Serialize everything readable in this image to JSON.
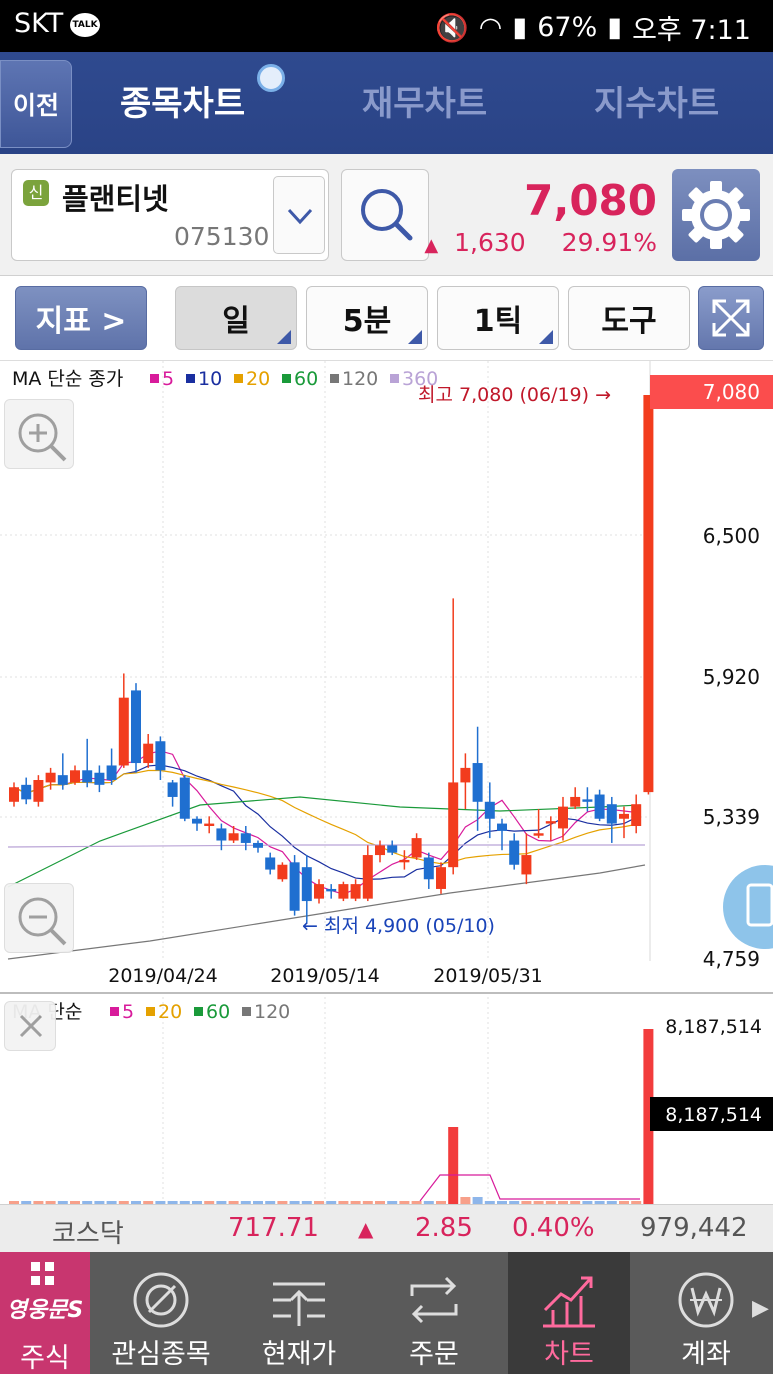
{
  "status_bar": {
    "carrier": "SKT",
    "talk_badge": "TALK",
    "battery": "67%",
    "time": "오후 7:11"
  },
  "header": {
    "back_label": "이전",
    "tabs": [
      {
        "label": "종목차트",
        "active": true
      },
      {
        "label": "재무차트",
        "active": false
      },
      {
        "label": "지수차트",
        "active": false
      }
    ]
  },
  "stock": {
    "badge": "신",
    "name": "플랜티넷",
    "code": "075130",
    "price": "7,080",
    "change_arrow": "▲",
    "change": "1,630",
    "change_pct": "29.91%",
    "up_color": "#d8245c"
  },
  "toolbar": {
    "indicator_label": "지표 >",
    "period_day": "일",
    "period_5min": "5분",
    "period_1tick": "1틱",
    "tools_label": "도구"
  },
  "price_chart": {
    "legend_prefix": "MA 단순 종가",
    "legend": [
      {
        "label": "5",
        "color": "#d81b9b"
      },
      {
        "label": "10",
        "color": "#1a2fa0"
      },
      {
        "label": "20",
        "color": "#e5a100"
      },
      {
        "label": "60",
        "color": "#1a9a3a"
      },
      {
        "label": "120",
        "color": "#777777"
      },
      {
        "label": "360",
        "color": "#b9a3d6"
      }
    ],
    "high_annotation": "최고 7,080 (06/19) →",
    "low_annotation": "← 최저 4,900 (05/10)",
    "current_price_tag": "7,080",
    "y_ticks": [
      "7,080",
      "6,500",
      "5,920",
      "5,339",
      "4,759"
    ],
    "x_ticks": [
      "2019/04/24",
      "2019/05/14",
      "2019/05/31"
    ]
  },
  "volume_chart": {
    "legend_prefix": "MA 단순",
    "legend": [
      {
        "label": "5",
        "color": "#d81b9b"
      },
      {
        "label": "20",
        "color": "#e5a100"
      },
      {
        "label": "60",
        "color": "#1a9a3a"
      },
      {
        "label": "120",
        "color": "#777777"
      }
    ],
    "max_label": "8,187,514",
    "current_tag": "8,187,514"
  },
  "chart_data": {
    "type": "candlestick",
    "title": "",
    "ylim": [
      4759,
      7080
    ],
    "y_ticks": [
      7080,
      6500,
      5920,
      5339,
      4759
    ],
    "x_ticks": [
      "2019/04/24",
      "2019/05/14",
      "2019/05/31"
    ],
    "high": {
      "value": 7080,
      "date": "06/19"
    },
    "low": {
      "value": 4900,
      "date": "05/10"
    },
    "candles": [
      {
        "o": 5400,
        "c": 5460,
        "h": 5480,
        "l": 5380
      },
      {
        "o": 5470,
        "c": 5410,
        "h": 5500,
        "l": 5390
      },
      {
        "o": 5400,
        "c": 5490,
        "h": 5510,
        "l": 5380
      },
      {
        "o": 5480,
        "c": 5520,
        "h": 5540,
        "l": 5450
      },
      {
        "o": 5510,
        "c": 5470,
        "h": 5600,
        "l": 5450
      },
      {
        "o": 5480,
        "c": 5530,
        "h": 5550,
        "l": 5470
      },
      {
        "o": 5530,
        "c": 5480,
        "h": 5660,
        "l": 5460
      },
      {
        "o": 5520,
        "c": 5470,
        "h": 5550,
        "l": 5440
      },
      {
        "o": 5550,
        "c": 5490,
        "h": 5620,
        "l": 5470
      },
      {
        "o": 5550,
        "c": 5830,
        "h": 5930,
        "l": 5540
      },
      {
        "o": 5860,
        "c": 5560,
        "h": 5890,
        "l": 5520
      },
      {
        "o": 5560,
        "c": 5640,
        "h": 5680,
        "l": 5540
      },
      {
        "o": 5650,
        "c": 5530,
        "h": 5670,
        "l": 5490
      },
      {
        "o": 5480,
        "c": 5420,
        "h": 5490,
        "l": 5380
      },
      {
        "o": 5500,
        "c": 5330,
        "h": 5510,
        "l": 5320
      },
      {
        "o": 5330,
        "c": 5310,
        "h": 5340,
        "l": 5280
      },
      {
        "o": 5300,
        "c": 5310,
        "h": 5340,
        "l": 5270
      },
      {
        "o": 5290,
        "c": 5240,
        "h": 5310,
        "l": 5200
      },
      {
        "o": 5240,
        "c": 5270,
        "h": 5300,
        "l": 5230
      },
      {
        "o": 5270,
        "c": 5230,
        "h": 5300,
        "l": 5200
      },
      {
        "o": 5230,
        "c": 5210,
        "h": 5240,
        "l": 5190
      },
      {
        "o": 5170,
        "c": 5120,
        "h": 5190,
        "l": 5100
      },
      {
        "o": 5080,
        "c": 5140,
        "h": 5150,
        "l": 5070
      },
      {
        "o": 5150,
        "c": 4950,
        "h": 5180,
        "l": 4930
      },
      {
        "o": 5130,
        "c": 4990,
        "h": 5180,
        "l": 4900
      },
      {
        "o": 5000,
        "c": 5060,
        "h": 5080,
        "l": 4980
      },
      {
        "o": 5040,
        "c": 5030,
        "h": 5060,
        "l": 5000
      },
      {
        "o": 5000,
        "c": 5060,
        "h": 5070,
        "l": 4990
      },
      {
        "o": 5000,
        "c": 5060,
        "h": 5080,
        "l": 4990
      },
      {
        "o": 5000,
        "c": 5180,
        "h": 5220,
        "l": 4990
      },
      {
        "o": 5180,
        "c": 5220,
        "h": 5240,
        "l": 5150
      },
      {
        "o": 5220,
        "c": 5190,
        "h": 5240,
        "l": 5180
      },
      {
        "o": 5150,
        "c": 5160,
        "h": 5200,
        "l": 5120
      },
      {
        "o": 5170,
        "c": 5250,
        "h": 5270,
        "l": 5160
      },
      {
        "o": 5170,
        "c": 5080,
        "h": 5190,
        "l": 5040
      },
      {
        "o": 5040,
        "c": 5130,
        "h": 5150,
        "l": 5020
      },
      {
        "o": 5130,
        "c": 5480,
        "h": 6240,
        "l": 5100
      },
      {
        "o": 5480,
        "c": 5540,
        "h": 5600,
        "l": 5370
      },
      {
        "o": 5560,
        "c": 5400,
        "h": 5710,
        "l": 5280
      },
      {
        "o": 5400,
        "c": 5330,
        "h": 5480,
        "l": 5250
      },
      {
        "o": 5310,
        "c": 5280,
        "h": 5330,
        "l": 5200
      },
      {
        "o": 5240,
        "c": 5140,
        "h": 5270,
        "l": 5120
      },
      {
        "o": 5100,
        "c": 5180,
        "h": 5270,
        "l": 5060
      },
      {
        "o": 5260,
        "c": 5270,
        "h": 5370,
        "l": 5250
      },
      {
        "o": 5310,
        "c": 5320,
        "h": 5340,
        "l": 5240
      },
      {
        "o": 5290,
        "c": 5380,
        "h": 5420,
        "l": 5240
      },
      {
        "o": 5380,
        "c": 5420,
        "h": 5460,
        "l": 5370
      },
      {
        "o": 5410,
        "c": 5400,
        "h": 5460,
        "l": 5360
      },
      {
        "o": 5430,
        "c": 5330,
        "h": 5450,
        "l": 5320
      },
      {
        "o": 5390,
        "c": 5310,
        "h": 5420,
        "l": 5230
      },
      {
        "o": 5330,
        "c": 5350,
        "h": 5380,
        "l": 5250
      },
      {
        "o": 5300,
        "c": 5390,
        "h": 5430,
        "l": 5270
      },
      {
        "o": 5440,
        "c": 7080,
        "h": 7080,
        "l": 5430
      }
    ]
  },
  "index_bar": {
    "name": "코스닥",
    "value": "717.71",
    "arrow": "▲",
    "change": "2.85",
    "pct": "0.40%",
    "volume": "979,442"
  },
  "bottom_nav": {
    "items": [
      {
        "label": "주식",
        "icon": "grid-icon"
      },
      {
        "label": "관심종목",
        "icon": "target-icon"
      },
      {
        "label": "현재가",
        "icon": "quote-icon"
      },
      {
        "label": "주문",
        "icon": "exchange-icon"
      },
      {
        "label": "차트",
        "icon": "chart-icon"
      },
      {
        "label": "계좌",
        "icon": "won-icon"
      }
    ],
    "brand_label": "영웅문S"
  }
}
